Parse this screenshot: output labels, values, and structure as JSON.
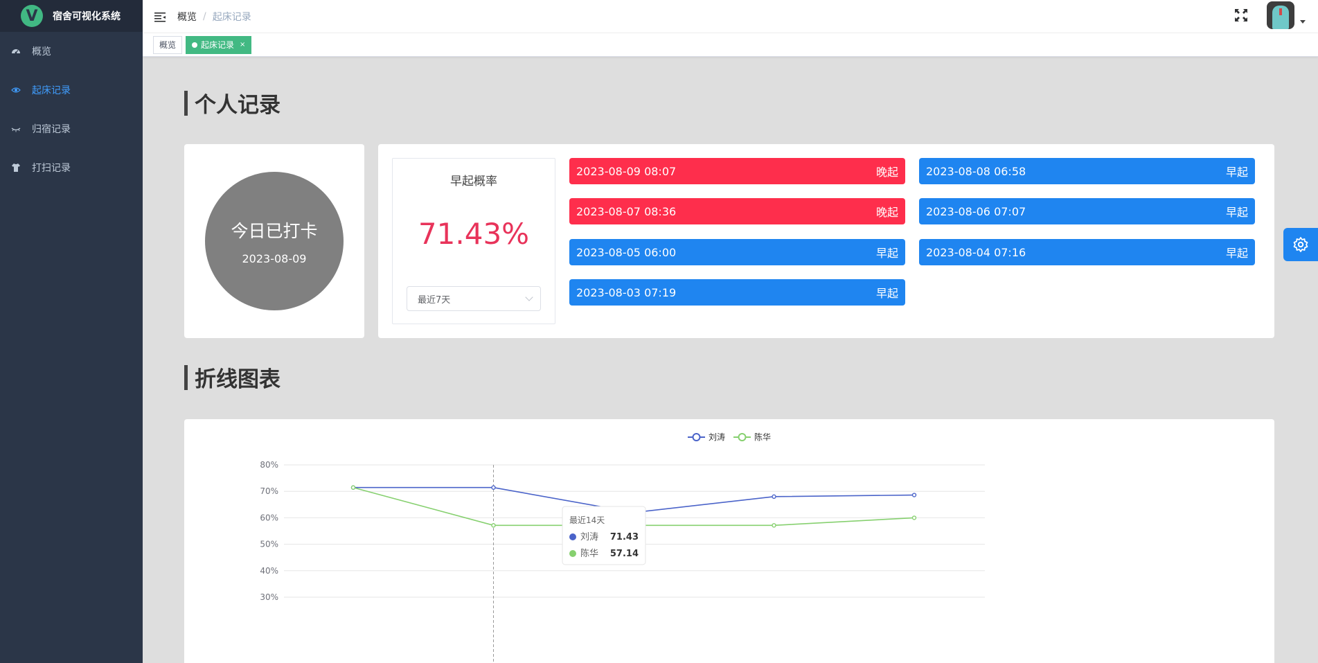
{
  "app": {
    "title": "宿舍可视化系统",
    "logo_letter": "V"
  },
  "sidebar": {
    "items": [
      {
        "label": "概览",
        "icon": "dashboard-icon",
        "active": false
      },
      {
        "label": "起床记录",
        "icon": "eye-icon",
        "active": true
      },
      {
        "label": "归宿记录",
        "icon": "eye-closed-icon",
        "active": false
      },
      {
        "label": "打扫记录",
        "icon": "shirt-icon",
        "active": false
      }
    ]
  },
  "breadcrumb": {
    "root": "概览",
    "separator": "/",
    "current": "起床记录"
  },
  "tags": [
    {
      "label": "概览",
      "active": false
    },
    {
      "label": "起床记录",
      "active": true,
      "close": "×"
    }
  ],
  "sections": {
    "personal": "个人记录",
    "chart": "折线图表"
  },
  "checkin": {
    "title": "今日已打卡",
    "date": "2023-08-09"
  },
  "rate": {
    "label": "早起概率",
    "value": "71.43%",
    "range": "最近7天"
  },
  "records": [
    {
      "time": "2023-08-09 08:07",
      "status": "晚起",
      "type": "late"
    },
    {
      "time": "2023-08-08 06:58",
      "status": "早起",
      "type": "early"
    },
    {
      "time": "2023-08-07 08:36",
      "status": "晚起",
      "type": "late"
    },
    {
      "time": "2023-08-06 07:07",
      "status": "早起",
      "type": "early"
    },
    {
      "time": "2023-08-05 06:00",
      "status": "早起",
      "type": "early"
    },
    {
      "time": "2023-08-04 07:16",
      "status": "早起",
      "type": "early"
    },
    {
      "time": "2023-08-03 07:19",
      "status": "早起",
      "type": "early"
    }
  ],
  "colors": {
    "accent": "#409eff",
    "late": "#fe2e4c",
    "early": "#1f85f0",
    "tag_active": "#42b983",
    "rate": "#e8335a",
    "series_1": "#4a63c9",
    "series_2": "#86d06f"
  },
  "chart_data": {
    "type": "line",
    "title": "",
    "xlabel": "",
    "ylabel": "",
    "y_unit": "%",
    "ylim": [
      30,
      80
    ],
    "y_ticks": [
      "80%",
      "70%",
      "60%",
      "50%",
      "40%",
      "30%"
    ],
    "legend_position": "top-center",
    "series": [
      {
        "name": "刘涛",
        "values": [
          71.43,
          71.43,
          62,
          68,
          68.6
        ]
      },
      {
        "name": "陈华",
        "values": [
          71.43,
          57.14,
          57.14,
          57.14,
          60
        ]
      }
    ],
    "tooltip": {
      "title": "最近14天",
      "rows": [
        {
          "name": "刘涛",
          "value": "71.43"
        },
        {
          "name": "陈华",
          "value": "57.14"
        }
      ]
    }
  }
}
